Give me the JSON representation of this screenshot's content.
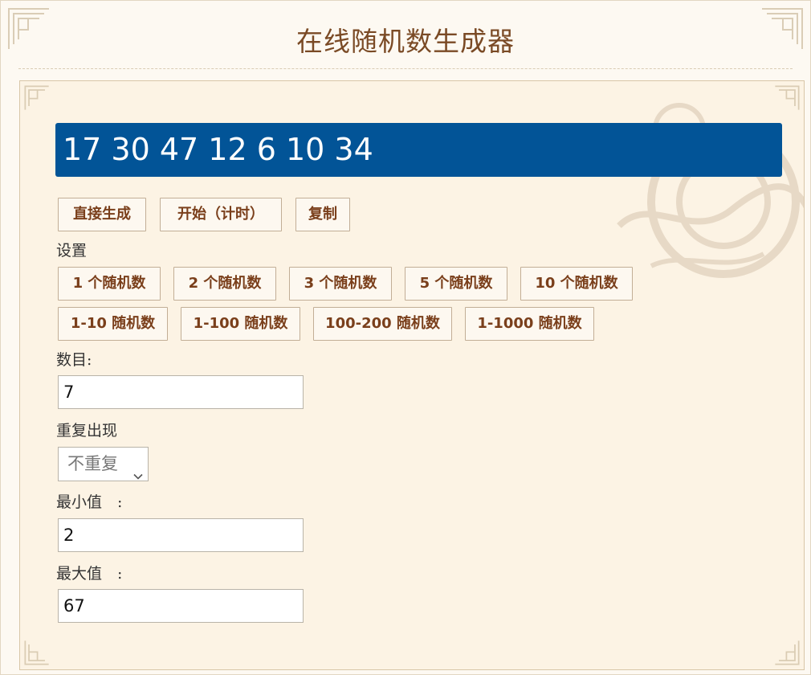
{
  "header": {
    "title": "在线随机数生成器"
  },
  "output": {
    "numbers": "17 30 47 12 6 10 34"
  },
  "actions": {
    "generate": "直接生成",
    "start_timer": "开始（计时）",
    "copy": "复制"
  },
  "settings": {
    "heading": "设置",
    "count_presets": [
      "1 个随机数",
      "2 个随机数",
      "3 个随机数",
      "5 个随机数",
      "10 个随机数"
    ],
    "range_presets": [
      "1-10 随机数",
      "1-100 随机数",
      "100-200 随机数",
      "1-1000 随机数"
    ]
  },
  "form": {
    "count_label": "数目:",
    "count_value": "7",
    "repeat_label": "重复出现",
    "repeat_value": "不重复",
    "min_label": "最小值　:",
    "min_value": "2",
    "max_label": "最大值　:",
    "max_value": "67"
  },
  "colors": {
    "accent": "#025497",
    "title": "#7a4a25",
    "button_text": "#7a3f1b"
  }
}
